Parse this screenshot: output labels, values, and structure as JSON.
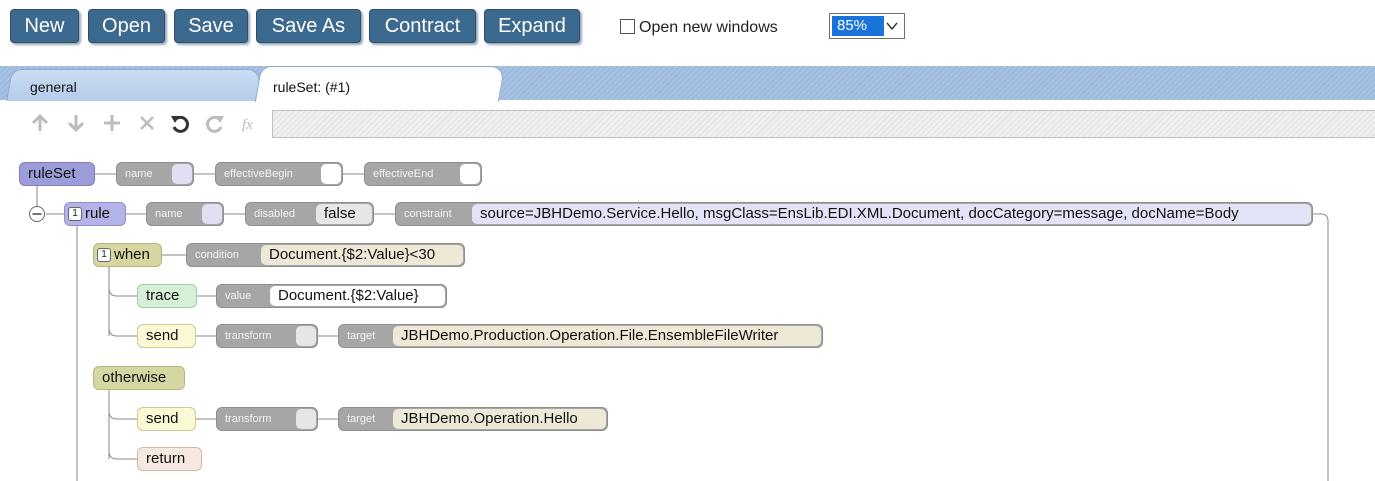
{
  "toolbar": {
    "new": "New",
    "open": "Open",
    "save": "Save",
    "save_as": "Save As",
    "contract": "Contract",
    "expand": "Expand",
    "open_new_windows": "Open new windows",
    "open_new_windows_checked": false,
    "zoom": "85%"
  },
  "tabs": {
    "general": "general",
    "ruleset": "ruleSet: (#1)"
  },
  "edit_icons": [
    "arrow-up-icon",
    "arrow-down-icon",
    "plus-icon",
    "delete-icon",
    "undo-icon",
    "redo-icon",
    "function-icon"
  ],
  "tree": {
    "ruleset": {
      "label": "ruleSet",
      "name_label": "name",
      "effective_begin_label": "effectiveBegin",
      "effective_end_label": "effectiveEnd"
    },
    "rule": {
      "index": "1",
      "label": "rule",
      "name_label": "name",
      "disabled_label": "disabled",
      "disabled_value": "false",
      "constraint_label": "constraint",
      "constraint_value": "source=JBHDemo.Service.Hello, msgClass=EnsLib.EDI.XML.Document, docCategory=message, docName=Body"
    },
    "when": {
      "index": "1",
      "label": "when",
      "condition_label": "condition",
      "condition_value": "Document.{$2:Value}<30"
    },
    "trace": {
      "label": "trace",
      "value_label": "value",
      "value": "Document.{$2:Value}"
    },
    "send1": {
      "label": "send",
      "transform_label": "transform",
      "target_label": "target",
      "target_value": "JBHDemo.Production.Operation.File.EnsembleFileWriter"
    },
    "otherwise": {
      "label": "otherwise"
    },
    "send2": {
      "label": "send",
      "transform_label": "transform",
      "target_label": "target",
      "target_value": "JBHDemo.Operation.Hello"
    },
    "return": {
      "label": "return"
    }
  },
  "colors": {
    "button": "#3c6a8f",
    "ruleset": "#9c9cd9",
    "when": "#d6d6a2",
    "property": "#a6a6a6"
  }
}
